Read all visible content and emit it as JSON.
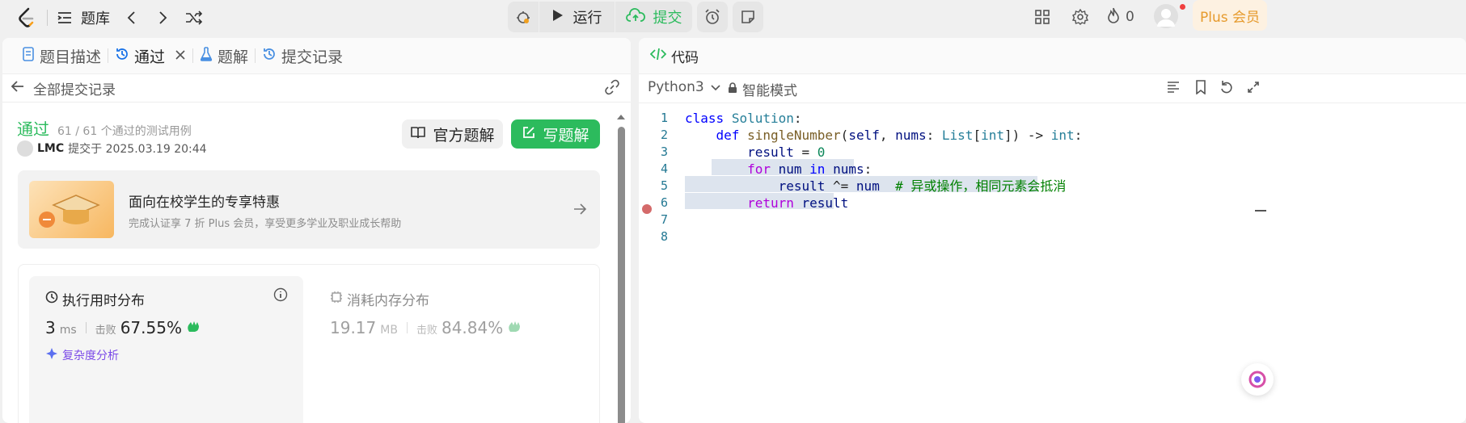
{
  "topbar": {
    "problem_bank": "题库",
    "run": "运行",
    "submit": "提交",
    "fire_count": "0",
    "plus": "Plus 会员"
  },
  "left": {
    "tabs": [
      "题目描述",
      "通过",
      "题解",
      "提交记录"
    ],
    "back": "全部提交记录",
    "status": "通过",
    "cases": "61 / 61 个通过的测试用例",
    "user": "LMC",
    "submitted_at": "提交于 2025.03.19 20:44",
    "btn_official": "官方题解",
    "btn_write": "写题解",
    "promo_title": "面向在校学生的专享特惠",
    "promo_sub": "完成认证享 7 折 Plus 会员，享受更多学业及职业成长帮助",
    "time_title": "执行用时分布",
    "time_value": "3",
    "time_unit": "ms",
    "beat_label": "击败",
    "time_beat": "67.55%",
    "mem_title": "消耗内存分布",
    "mem_value": "19.17",
    "mem_unit": "MB",
    "mem_beat": "84.84%",
    "complexity": "复杂度分析"
  },
  "right": {
    "title": "代码",
    "lang": "Python3",
    "mode": "智能模式",
    "line_numbers": [
      "1",
      "2",
      "3",
      "4",
      "5",
      "6",
      "7",
      "8"
    ]
  },
  "colors": {
    "accent_green": "#2cbb5d",
    "plus_bg": "#fdf1e1",
    "plus_text": "#e69a2c"
  }
}
